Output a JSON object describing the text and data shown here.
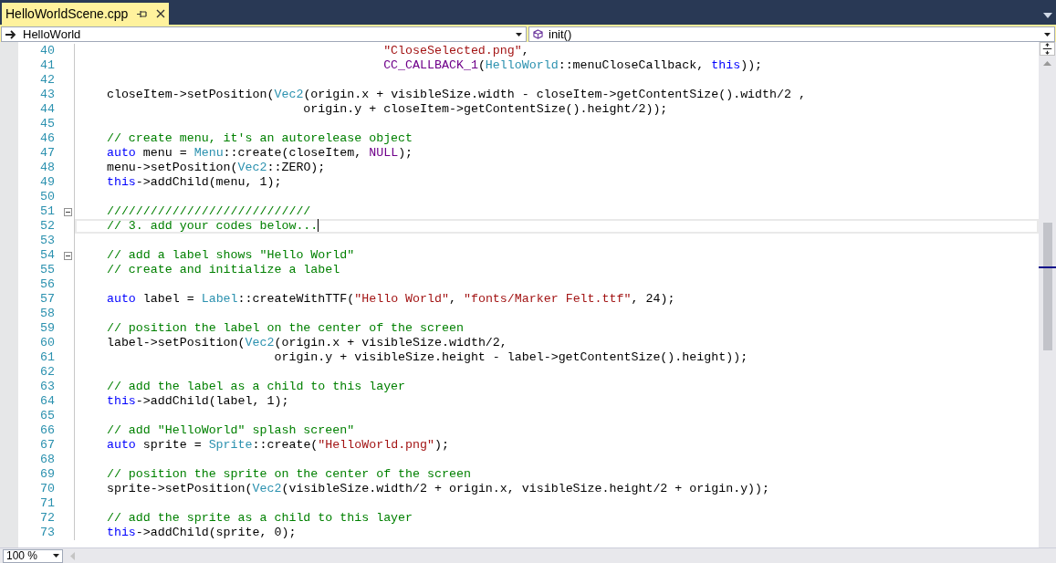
{
  "tabs": [
    {
      "label": "HelloWorldScene.cpp",
      "selected": true
    }
  ],
  "navigation": {
    "scope": "HelloWorld",
    "member": "init()"
  },
  "editor": {
    "lines": [
      {
        "number": "40",
        "current": false,
        "tokens": [
          {
            "text": "                                          \"CloseSelected.png\"",
            "kind": "string"
          },
          {
            "text": ",",
            "kind": "plain"
          }
        ]
      },
      {
        "number": "41",
        "current": false,
        "tokens": [
          {
            "text": "                                          CC_CALLBACK_1",
            "kind": "macro"
          },
          {
            "text": "(",
            "kind": "plain"
          },
          {
            "text": "HelloWorld",
            "kind": "type"
          },
          {
            "text": "::menuCloseCallback, ",
            "kind": "plain"
          },
          {
            "text": "this",
            "kind": "keyword"
          },
          {
            "text": "));",
            "kind": "plain"
          }
        ]
      },
      {
        "number": "42",
        "current": false
      },
      {
        "number": "43",
        "current": false,
        "tokens": [
          {
            "text": "    closeItem->setPosition(",
            "kind": "plain"
          },
          {
            "text": "Vec2",
            "kind": "type"
          },
          {
            "text": "(origin.x + visibleSize.width - closeItem->getContentSize().width/2 ,",
            "kind": "plain"
          }
        ]
      },
      {
        "number": "44",
        "current": false,
        "tokens": [
          {
            "text": "                               origin.y + closeItem->getContentSize().height/2));",
            "kind": "plain"
          }
        ]
      },
      {
        "number": "45",
        "current": false
      },
      {
        "number": "46",
        "current": false,
        "tokens": [
          {
            "text": "    // create menu, it's an autorelease object",
            "kind": "comment"
          }
        ]
      },
      {
        "number": "47",
        "current": false,
        "tokens": [
          {
            "text": "    auto",
            "kind": "keyword"
          },
          {
            "text": " menu = ",
            "kind": "plain"
          },
          {
            "text": "Menu",
            "kind": "type"
          },
          {
            "text": "::create(closeItem, ",
            "kind": "plain"
          },
          {
            "text": "NULL",
            "kind": "macro"
          },
          {
            "text": ");",
            "kind": "plain"
          }
        ]
      },
      {
        "number": "48",
        "current": false,
        "tokens": [
          {
            "text": "    menu->setPosition(",
            "kind": "plain"
          },
          {
            "text": "Vec2",
            "kind": "type"
          },
          {
            "text": "::ZERO);",
            "kind": "plain"
          }
        ]
      },
      {
        "number": "49",
        "current": false,
        "tokens": [
          {
            "text": "    this",
            "kind": "keyword"
          },
          {
            "text": "->addChild(menu, 1);",
            "kind": "plain"
          }
        ]
      },
      {
        "number": "50",
        "current": false
      },
      {
        "number": "51",
        "current": false,
        "expanded": true,
        "tokens": [
          {
            "text": "    ////////////////////////////",
            "kind": "comment"
          }
        ]
      },
      {
        "number": "52",
        "current": true,
        "tokens": [
          {
            "text": "    // 3. add your codes below...",
            "kind": "comment"
          }
        ]
      },
      {
        "number": "53",
        "current": false
      },
      {
        "number": "54",
        "current": false,
        "expanded": true,
        "tokens": [
          {
            "text": "    // add a label shows \"Hello World\"",
            "kind": "comment"
          }
        ]
      },
      {
        "number": "55",
        "current": false,
        "tokens": [
          {
            "text": "    // create and initialize a label",
            "kind": "comment"
          }
        ]
      },
      {
        "number": "56",
        "current": false
      },
      {
        "number": "57",
        "current": false,
        "tokens": [
          {
            "text": "    auto",
            "kind": "keyword"
          },
          {
            "text": " label = ",
            "kind": "plain"
          },
          {
            "text": "Label",
            "kind": "type"
          },
          {
            "text": "::createWithTTF(",
            "kind": "plain"
          },
          {
            "text": "\"Hello World\"",
            "kind": "string"
          },
          {
            "text": ", ",
            "kind": "plain"
          },
          {
            "text": "\"fonts/Marker Felt.ttf\"",
            "kind": "string"
          },
          {
            "text": ", 24);",
            "kind": "plain"
          }
        ]
      },
      {
        "number": "58",
        "current": false
      },
      {
        "number": "59",
        "current": false,
        "tokens": [
          {
            "text": "    // position the label on the center of the screen",
            "kind": "comment"
          }
        ]
      },
      {
        "number": "60",
        "current": false,
        "tokens": [
          {
            "text": "    label->setPosition(",
            "kind": "plain"
          },
          {
            "text": "Vec2",
            "kind": "type"
          },
          {
            "text": "(origin.x + visibleSize.width/2,",
            "kind": "plain"
          }
        ]
      },
      {
        "number": "61",
        "current": false,
        "tokens": [
          {
            "text": "                           origin.y + visibleSize.height - label->getContentSize().height));",
            "kind": "plain"
          }
        ]
      },
      {
        "number": "62",
        "current": false
      },
      {
        "number": "63",
        "current": false,
        "tokens": [
          {
            "text": "    // add the label as a child to this layer",
            "kind": "comment"
          }
        ]
      },
      {
        "number": "64",
        "current": false,
        "tokens": [
          {
            "text": "    this",
            "kind": "keyword"
          },
          {
            "text": "->addChild(label, 1);",
            "kind": "plain"
          }
        ]
      },
      {
        "number": "65",
        "current": false
      },
      {
        "number": "66",
        "current": false,
        "tokens": [
          {
            "text": "    // add \"HelloWorld\" splash screen\"",
            "kind": "comment"
          }
        ]
      },
      {
        "number": "67",
        "current": false,
        "tokens": [
          {
            "text": "    auto",
            "kind": "keyword"
          },
          {
            "text": " sprite = ",
            "kind": "plain"
          },
          {
            "text": "Sprite",
            "kind": "type"
          },
          {
            "text": "::create(",
            "kind": "plain"
          },
          {
            "text": "\"HelloWorld.png\"",
            "kind": "string"
          },
          {
            "text": ");",
            "kind": "plain"
          }
        ]
      },
      {
        "number": "68",
        "current": false
      },
      {
        "number": "69",
        "current": false,
        "tokens": [
          {
            "text": "    // position the sprite on the center of the screen",
            "kind": "comment"
          }
        ]
      },
      {
        "number": "70",
        "current": false,
        "tokens": [
          {
            "text": "    sprite->setPosition(",
            "kind": "plain"
          },
          {
            "text": "Vec2",
            "kind": "type"
          },
          {
            "text": "(visibleSize.width/2 + origin.x, visibleSize.height/2 + origin.y));",
            "kind": "plain"
          }
        ]
      },
      {
        "number": "71",
        "current": false
      },
      {
        "number": "72",
        "current": false,
        "tokens": [
          {
            "text": "    // add the sprite as a child to this layer",
            "kind": "comment"
          }
        ]
      },
      {
        "number": "73",
        "current": false,
        "tokens": [
          {
            "text": "    this",
            "kind": "keyword"
          },
          {
            "text": "->addChild(sprite, 0);",
            "kind": "plain"
          }
        ]
      }
    ]
  },
  "zoom": "100 %"
}
